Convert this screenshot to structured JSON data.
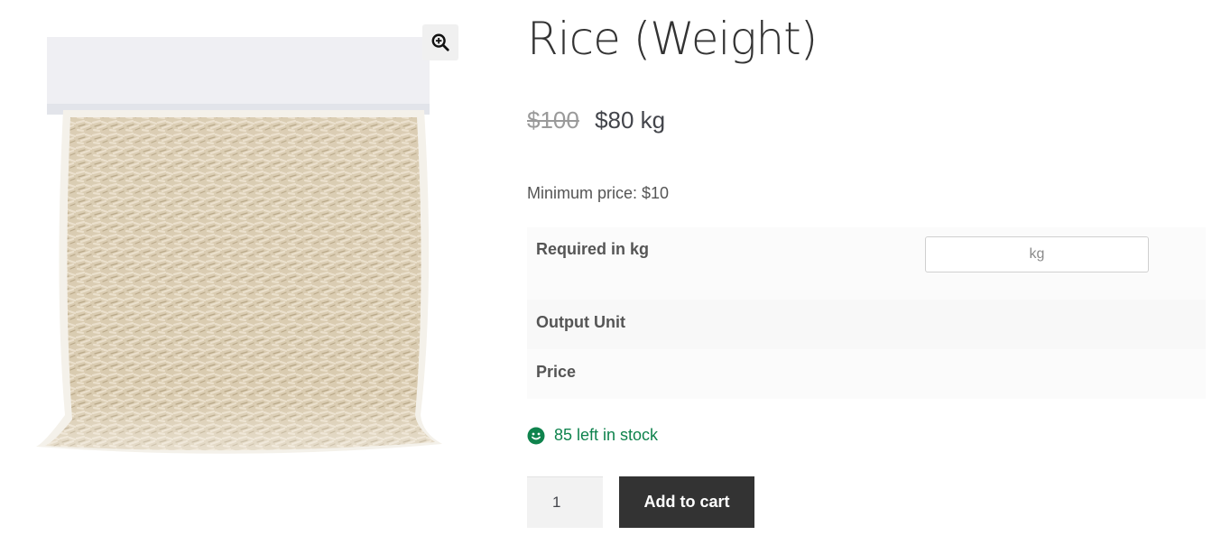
{
  "product": {
    "title": "Rice (Weight)",
    "image_alt": "Bag of rice",
    "old_price": "$100",
    "new_price": "$80 kg",
    "min_price": "Minimum price: $10"
  },
  "fields": {
    "required_label": "Required in kg",
    "required_placeholder": "kg",
    "output_unit_label": "Output Unit",
    "price_label": "Price"
  },
  "stock": {
    "text": "85 left in stock",
    "icon": "smiley-icon"
  },
  "cart": {
    "quantity": "1",
    "add_to_cart_label": "Add to cart"
  },
  "gallery": {
    "zoom_icon": "zoom-in-icon"
  },
  "colors": {
    "stock_green": "#0f834d",
    "button_dark": "#333333",
    "old_price_grey": "#9a9a9a"
  }
}
